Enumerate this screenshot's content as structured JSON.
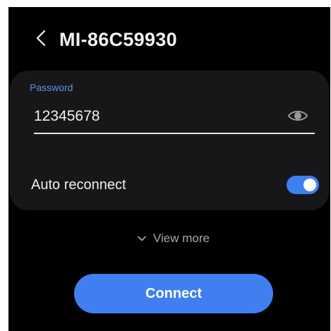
{
  "header": {
    "title": "MI-86C59930",
    "back_icon": "chevron-left-icon"
  },
  "password": {
    "label": "Password",
    "value": "12345678",
    "visibility_icon": "eye-icon"
  },
  "auto_reconnect": {
    "label": "Auto reconnect",
    "enabled": true
  },
  "view_more": {
    "label": "View more",
    "icon": "chevron-down-icon"
  },
  "connect": {
    "label": "Connect"
  },
  "colors": {
    "accent": "#3f7ff0",
    "label_blue": "#5b93e8",
    "card_bg": "#17171a",
    "screen_bg": "#000000"
  }
}
